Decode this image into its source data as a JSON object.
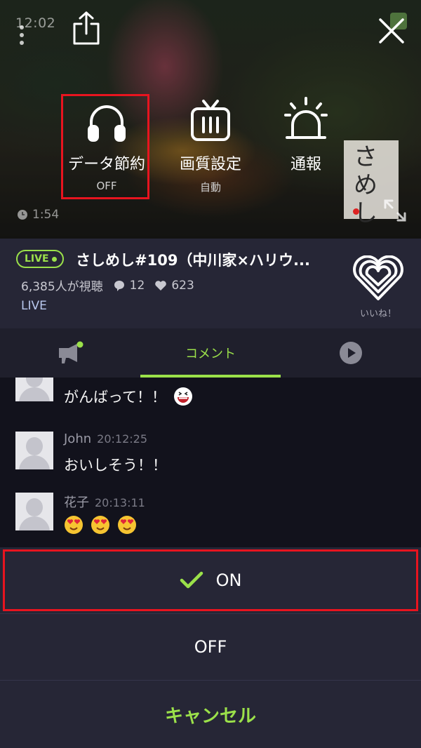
{
  "status_bar": {
    "time": "12:02"
  },
  "video_controls": [
    {
      "id": "data",
      "label": "データ節約",
      "sub": "OFF",
      "icon": "headphones-icon"
    },
    {
      "id": "quality",
      "label": "画質設定",
      "sub": "自動",
      "icon": "tv-icon"
    },
    {
      "id": "report",
      "label": "通報",
      "sub": "",
      "icon": "alarm-icon"
    }
  ],
  "video": {
    "duration": "1:54",
    "thumbnail_text": "さめし"
  },
  "broadcast": {
    "live_badge": "LIVE",
    "title": "さしめし#109（中川家×ハリウ...",
    "viewers": "6,385人が視聴",
    "comments": "12",
    "likes": "623",
    "status": "LIVE",
    "like_label": "いいね！"
  },
  "tabs": {
    "comment_label": "コメント"
  },
  "comments": [
    {
      "name": "",
      "time": "",
      "text": "がんばって！！",
      "emoji": [
        "grin-emoji"
      ]
    },
    {
      "name": "John",
      "time": "20:12:25",
      "text": "おいしそう！！",
      "emoji": []
    },
    {
      "name": "花子",
      "time": "20:13:11",
      "text": "",
      "emoji": [
        "heart-eyes-emoji",
        "heart-eyes-emoji",
        "heart-eyes-emoji"
      ]
    }
  ],
  "sheet": {
    "on_label": "ON",
    "off_label": "OFF",
    "cancel_label": "キャンセル"
  },
  "colors": {
    "accent": "#9be14a",
    "highlight": "#e8141f",
    "panel": "#262636"
  }
}
